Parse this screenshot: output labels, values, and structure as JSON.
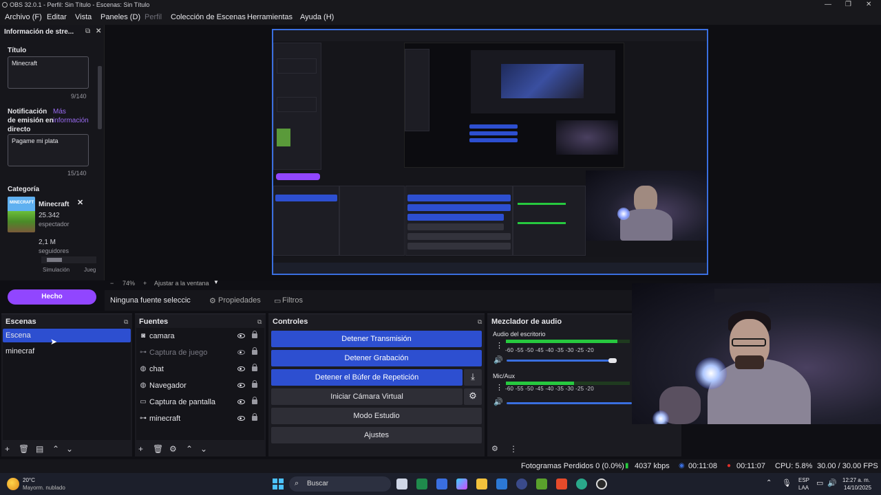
{
  "window": {
    "title": "OBS 32.0.1 - Perfil: Sin Título - Escenas: Sin Título"
  },
  "menu": [
    "Archivo (F)",
    "Editar",
    "Vista",
    "Paneles (D)",
    "Perfil",
    "Colección de Escenas",
    "Herramientas",
    "Ayuda (H)"
  ],
  "info_dock": {
    "header": "Información de stre...",
    "title_label": "Título",
    "title_value": "Minecraft",
    "title_count": "9/140",
    "notif_label_1": "Notificación",
    "notif_label_2": "de emisión en",
    "notif_label_3": "directo",
    "notif_link_1": "Más",
    "notif_link_2": "información",
    "notif_value": "Pagame mi plata",
    "notif_count": "15/140",
    "category_label": "Categoría",
    "category_thumb": "MINECRAFT",
    "category_name": "Minecraft",
    "viewers": "25.342",
    "viewers_label": "espectador",
    "followers": "2,1 M",
    "followers_label": "seguidores",
    "tag_1": "Simulación",
    "tag_2": "Jueg",
    "done_button": "Hecho"
  },
  "zoom": {
    "minus": "−",
    "value": "74%",
    "plus": "+",
    "fit": "Ajustar a la ventana"
  },
  "source_bar": {
    "no_source": "Ninguna fuente seleccic",
    "properties": "Propiedades",
    "filters": "Filtros"
  },
  "scenes": {
    "title": "Escenas",
    "items": [
      "Escena",
      "minecraf"
    ]
  },
  "sources": {
    "title": "Fuentes",
    "items": [
      {
        "name": "camara",
        "icon": "camera-icon"
      },
      {
        "name": "Captura de juego",
        "icon": "gamepad-icon"
      },
      {
        "name": "chat",
        "icon": "globe-icon"
      },
      {
        "name": "Navegador",
        "icon": "globe-icon"
      },
      {
        "name": "Captura de pantalla",
        "icon": "monitor-icon"
      },
      {
        "name": "minecraft",
        "icon": "gamepad-icon"
      }
    ]
  },
  "controls": {
    "title": "Controles",
    "stop_stream": "Detener Transmisión",
    "stop_record": "Detener Grabación",
    "stop_replay": "Detener el Búfer de Repetición",
    "virtual_cam": "Iniciar Cámara Virtual",
    "studio_mode": "Modo Estudio",
    "settings": "Ajustes"
  },
  "mixer": {
    "title": "Mezclador de audio",
    "channels": [
      {
        "name": "Audio del escritorio",
        "level": 0.9
      },
      {
        "name": "Mic/Aux",
        "level": 0.55
      }
    ],
    "ticks": "-60  -55  -50  -45  -40  -35  -30  -25  -20"
  },
  "status": {
    "dropped": "Fotogramas Perdidos 0 (0.0%)",
    "bitrate": "4037 kbps",
    "stream_time": "00:11:08",
    "rec_time": "00:11:07",
    "cpu": "CPU: 5.8%",
    "fps": "30.00 / 30.00 FPS"
  },
  "taskbar": {
    "weather_temp": "20°C",
    "weather_desc": "Mayorm. nublado",
    "search": "Buscar",
    "lang_1": "ESP",
    "lang_2": "LAA",
    "time": "12:27 a. m.",
    "date": "14/10/2025"
  },
  "colors": {
    "accent_blue": "#2d4fd0",
    "twitch_purple": "#9146ff",
    "live_red": "#e0302a",
    "meter_green": "#27c93f"
  }
}
